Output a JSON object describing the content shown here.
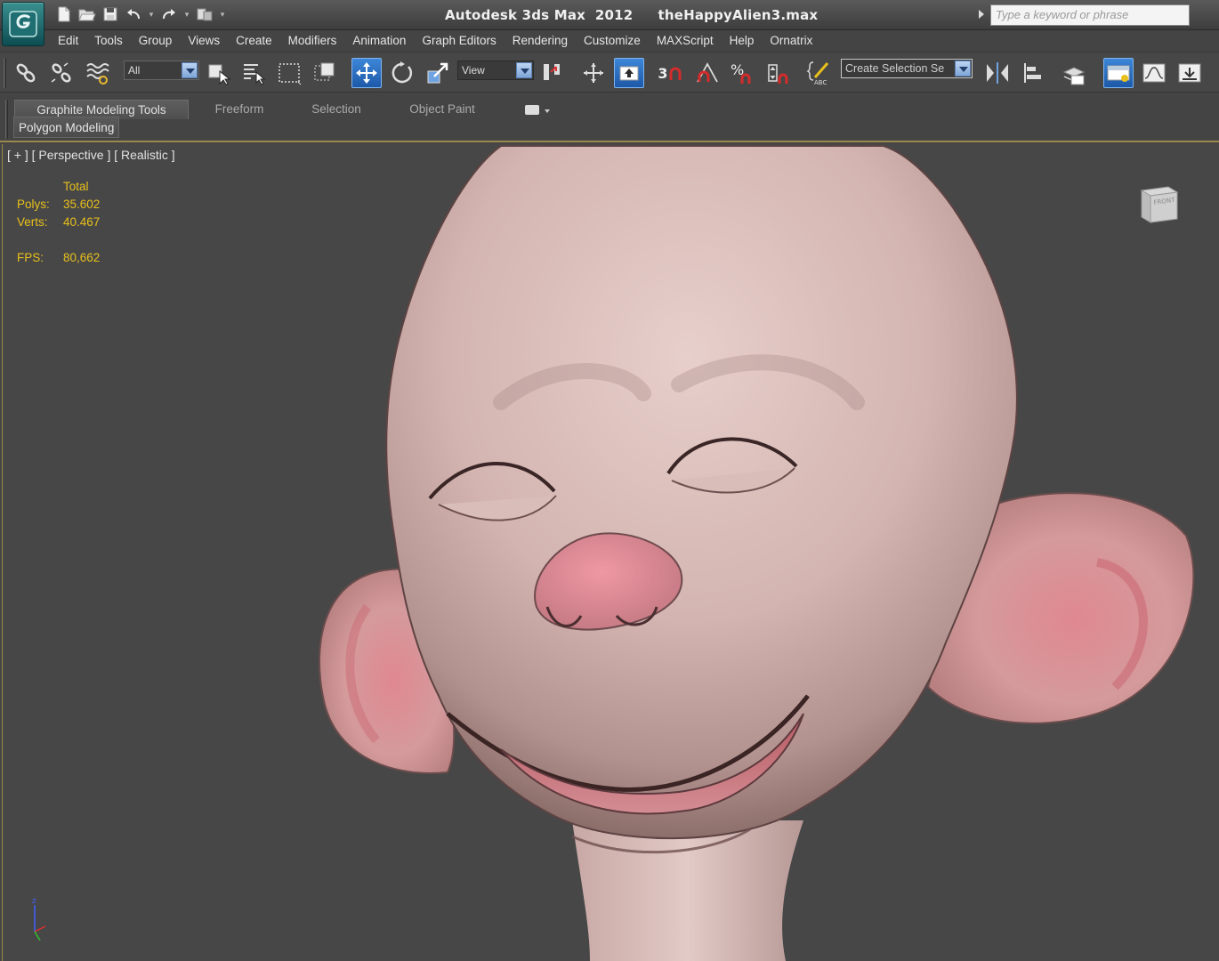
{
  "titlebar": {
    "app_title": "Autodesk 3ds Max  2012",
    "file_name": "theHappyAlien3.max",
    "search_placeholder": "Type a keyword or phrase"
  },
  "menu": [
    "Edit",
    "Tools",
    "Group",
    "Views",
    "Create",
    "Modifiers",
    "Animation",
    "Graph Editors",
    "Rendering",
    "Customize",
    "MAXScript",
    "Help",
    "Ornatrix"
  ],
  "toolbar": {
    "selection_filter": "All",
    "reference_coord": "View",
    "snap_angle_label": "3",
    "named_selection": "Create Selection Se"
  },
  "ribbon": {
    "tabs": [
      "Graphite Modeling Tools",
      "Freeform",
      "Selection",
      "Object Paint"
    ],
    "active_tab": "Graphite Modeling Tools",
    "panel": "Polygon Modeling"
  },
  "viewport": {
    "label": "[ + ] [ Perspective ] [ Realistic ]",
    "stats": {
      "header": "Total",
      "polys_label": "Polys:",
      "polys": "35.602",
      "verts_label": "Verts:",
      "verts": "40.467",
      "fps_label": "FPS:",
      "fps": "80,662"
    },
    "viewcube_face": "FRONT",
    "gizmo_axis": "z"
  },
  "colors": {
    "stats_text": "#e8c01c",
    "viewport_bg": "#474747",
    "active_border": "#9c8a4c",
    "active_tool": "#2e6fc4"
  }
}
